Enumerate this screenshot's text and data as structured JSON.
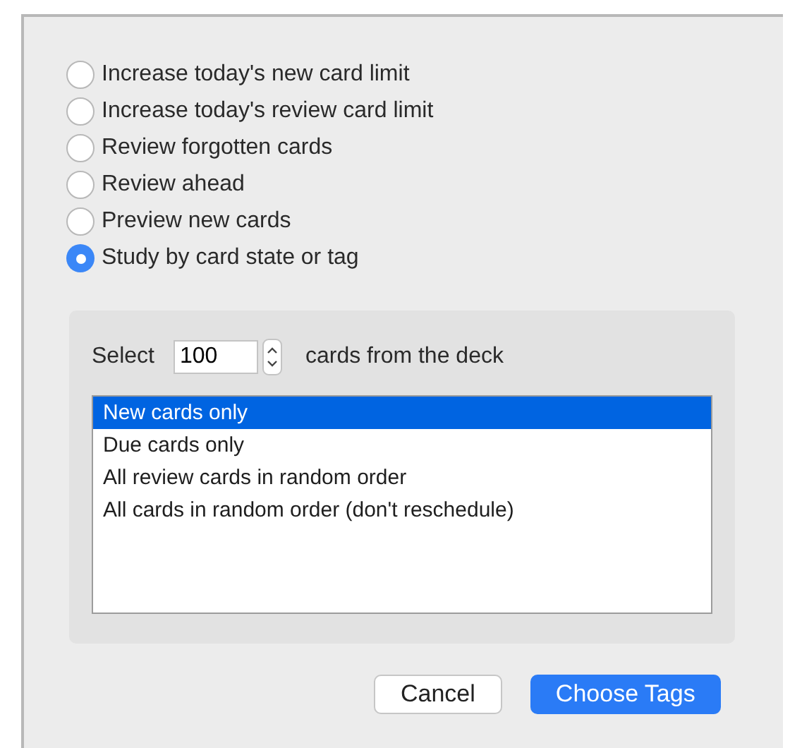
{
  "options": [
    {
      "label": "Increase today's new card limit",
      "selected": false
    },
    {
      "label": "Increase today's review card limit",
      "selected": false
    },
    {
      "label": "Review forgotten cards",
      "selected": false
    },
    {
      "label": "Review ahead",
      "selected": false
    },
    {
      "label": "Preview new cards",
      "selected": false
    },
    {
      "label": "Study by card state or tag",
      "selected": true
    }
  ],
  "select_row": {
    "prefix": "Select",
    "value": "100",
    "suffix": "cards from the deck"
  },
  "card_types": [
    {
      "label": "New cards only",
      "selected": true
    },
    {
      "label": "Due cards only",
      "selected": false
    },
    {
      "label": "All review cards in random order",
      "selected": false
    },
    {
      "label": "All cards in random order (don't reschedule)",
      "selected": false
    }
  ],
  "buttons": [
    {
      "label": "Cancel",
      "kind": "normal"
    },
    {
      "label": "Choose Tags",
      "kind": "default"
    }
  ]
}
